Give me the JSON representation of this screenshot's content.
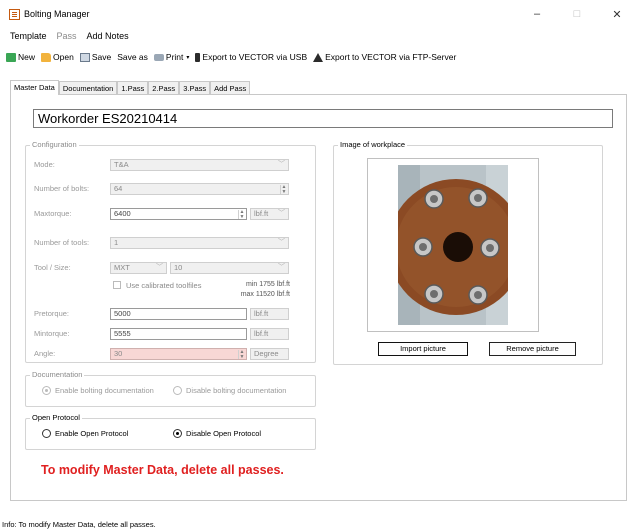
{
  "window": {
    "title": "Bolting Manager",
    "minimize": "–",
    "maximize": "□",
    "close": "✕"
  },
  "menu": {
    "items": [
      {
        "label": "Template",
        "enabled": true
      },
      {
        "label": "Pass",
        "enabled": false
      },
      {
        "label": "Add Notes",
        "enabled": true
      }
    ]
  },
  "toolbar": {
    "new": "New",
    "open": "Open",
    "save": "Save",
    "save_as": "Save as",
    "print": "Print",
    "print_caret": "▾",
    "export_usb": "Export to VECTOR via USB",
    "export_ftp": "Export to VECTOR via FTP-Server"
  },
  "tabs": [
    {
      "label": "Master Data",
      "active": true
    },
    {
      "label": "Documentation",
      "active": false
    },
    {
      "label": "1.Pass",
      "active": false
    },
    {
      "label": "2.Pass",
      "active": false
    },
    {
      "label": "3.Pass",
      "active": false
    },
    {
      "label": "Add Pass",
      "active": false
    }
  ],
  "master": {
    "workorder": "Workorder ES20210414",
    "configuration": {
      "legend": "Configuration",
      "mode_label": "Mode:",
      "mode_value": "T&A",
      "bolts_label": "Number of bolts:",
      "bolts_value": "64",
      "maxtorque_label": "Maxtorque:",
      "maxtorque_value": "6400",
      "maxtorque_unit": "lbf.ft",
      "tools_label": "Number of tools:",
      "tools_value": "1",
      "tool_label": "Tool / Size:",
      "tool_value": "MXT",
      "size_value": "10",
      "calibrated_label": "Use calibrated toolfiles",
      "calibrated_checked": false,
      "min_note": "min 1755 lbf.ft",
      "max_note": "max 11520 lbf.ft",
      "pretorque_label": "Pretorque:",
      "pretorque_value": "5000",
      "pretorque_unit": "lbf.ft",
      "mintorque_label": "Mintorque:",
      "mintorque_value": "5555",
      "mintorque_unit": "lbf.ft",
      "angle_label": "Angle:",
      "angle_value": "30",
      "angle_unit": "Degree"
    },
    "documentation": {
      "legend": "Documentation",
      "enable_label": "Enable bolting documentation",
      "disable_label": "Disable bolting documentation",
      "selected": "enable"
    },
    "open_protocol": {
      "legend": "Open Protocol",
      "enable_label": "Enable Open Protocol",
      "disable_label": "Disable Open Protocol",
      "selected": "disable"
    },
    "image": {
      "legend": "Image of workplace",
      "import_button": "Import picture",
      "remove_button": "Remove picture"
    },
    "warning": "To modify Master Data, delete all passes."
  },
  "status": {
    "text": "Info:  To modify Master Data, delete all passes."
  },
  "colors": {
    "warning": "#e02020",
    "angle_field": "#f8d7d5",
    "flange": "#8b4a24"
  },
  "icons": [
    "app-icon",
    "new-icon",
    "open-icon",
    "save-icon",
    "print-icon",
    "usb-icon",
    "ftp-icon",
    "dropdown-arrow-icon",
    "spinner-icon"
  ]
}
